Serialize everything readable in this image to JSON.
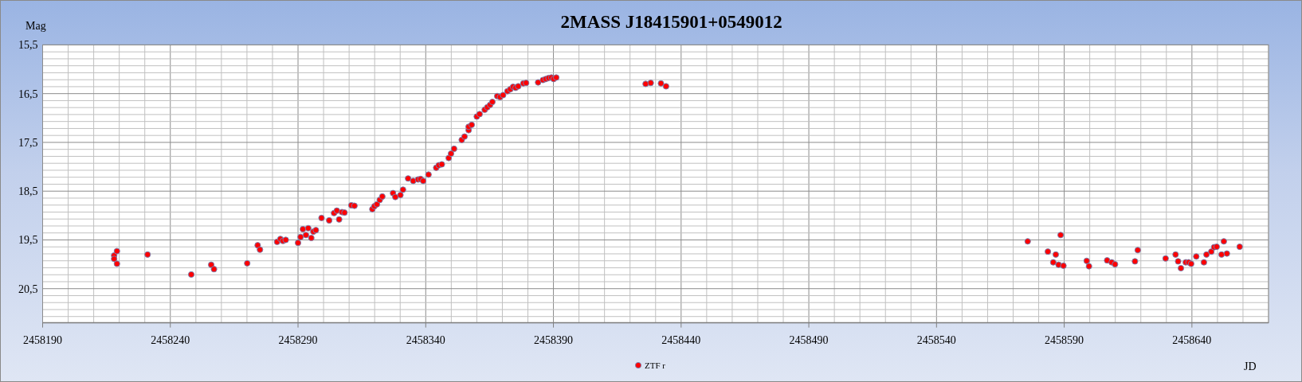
{
  "chart_data": {
    "type": "scatter",
    "title": "2MASS J18415901+0549012",
    "xlabel": "JD",
    "ylabel": "Mag",
    "grid": true,
    "xlim": [
      2458190,
      2458670
    ],
    "ylim": [
      21.2,
      15.5
    ],
    "xticks": [
      2458190,
      2458240,
      2458290,
      2458340,
      2458390,
      2458440,
      2458490,
      2458540,
      2458590,
      2458640
    ],
    "yticks": [
      {
        "value": 15.5,
        "label": "15,5"
      },
      {
        "value": 16.5,
        "label": "16,5"
      },
      {
        "value": 17.5,
        "label": "17,5"
      },
      {
        "value": 18.5,
        "label": "18,5"
      },
      {
        "value": 19.5,
        "label": "19,5"
      },
      {
        "value": 20.5,
        "label": "20,5"
      }
    ],
    "x": [
      2458218.0,
      2458218.0,
      2458219.1,
      2458219.1,
      2458231.1,
      2458248.2,
      2458256.0,
      2458257.1,
      2458270.1,
      2458274.2,
      2458275.1,
      2458281.8,
      2458283.1,
      2458284.1,
      2458285.2,
      2458290.0,
      2458291.0,
      2458291.9,
      2458293.1,
      2458294.0,
      2458295.2,
      2458296.0,
      2458297.0,
      2458299.2,
      2458302.2,
      2458304.1,
      2458305.2,
      2458306.1,
      2458307.2,
      2458308.2,
      2458310.9,
      2458312.1,
      2458319.1,
      2458319.9,
      2458320.9,
      2458322.0,
      2458323.0,
      2458327.2,
      2458328.1,
      2458330.1,
      2458331.1,
      2458333.1,
      2458335.1,
      2458337.0,
      2458338.0,
      2458339.0,
      2458341.1,
      2458344.1,
      2458345.1,
      2458346.3,
      2458349.0,
      2458349.9,
      2458351.1,
      2458354.1,
      2458355.2,
      2458356.8,
      2458356.8,
      2458358.0,
      2458360.0,
      2458361.1,
      2458363.1,
      2458364.1,
      2458365.2,
      2458366.1,
      2458368.0,
      2458369.1,
      2458370.3,
      2458372.0,
      2458373.1,
      2458374.2,
      2458375.2,
      2458376.2,
      2458378.2,
      2458379.3,
      2458384.0,
      2458385.9,
      2458387.0,
      2458388.1,
      2458389.2,
      2458390.1,
      2458391.1,
      2458426.1,
      2458428.1,
      2458432.1,
      2458434.1,
      2458575.7,
      2458583.6,
      2458585.7,
      2458586.7,
      2458587.8,
      2458588.6,
      2458589.7,
      2458598.8,
      2458599.7,
      2458606.8,
      2458608.6,
      2458609.9,
      2458617.7,
      2458618.8,
      2458629.7,
      2458633.6,
      2458634.6,
      2458635.7,
      2458637.6,
      2458638.7,
      2458639.7,
      2458641.7,
      2458644.7,
      2458645.7,
      2458647.6,
      2458648.7,
      2458649.7,
      2458651.6,
      2458652.5,
      2458653.7,
      2458658.7
    ],
    "series": [
      {
        "name": "ZTF r",
        "color": "#ff0000",
        "values": [
          19.82,
          19.89,
          19.73,
          19.99,
          19.8,
          20.21,
          20.01,
          20.1,
          19.98,
          19.61,
          19.7,
          19.54,
          19.48,
          19.52,
          19.5,
          19.56,
          19.44,
          19.28,
          19.4,
          19.26,
          19.46,
          19.33,
          19.3,
          19.05,
          19.1,
          18.95,
          18.9,
          19.08,
          18.93,
          18.94,
          18.79,
          18.8,
          18.87,
          18.81,
          18.77,
          18.68,
          18.61,
          18.54,
          18.62,
          18.58,
          18.47,
          18.24,
          18.29,
          18.26,
          18.25,
          18.29,
          18.16,
          18.02,
          17.97,
          17.95,
          17.82,
          17.73,
          17.63,
          17.45,
          17.38,
          17.25,
          17.18,
          17.14,
          16.97,
          16.92,
          16.83,
          16.78,
          16.73,
          16.67,
          16.55,
          16.57,
          16.53,
          16.45,
          16.41,
          16.36,
          16.38,
          16.35,
          16.29,
          16.28,
          16.27,
          16.22,
          16.2,
          16.18,
          16.17,
          16.2,
          16.17,
          16.3,
          16.28,
          16.29,
          16.35,
          19.53,
          19.74,
          19.96,
          19.8,
          20.01,
          19.4,
          20.03,
          19.93,
          20.04,
          19.92,
          19.96,
          20.0,
          19.94,
          19.71,
          19.88,
          19.8,
          19.94,
          20.08,
          19.96,
          19.96,
          19.99,
          19.84,
          19.96,
          19.8,
          19.74,
          19.65,
          19.64,
          19.8,
          19.53,
          19.78,
          19.64
        ]
      }
    ]
  }
}
